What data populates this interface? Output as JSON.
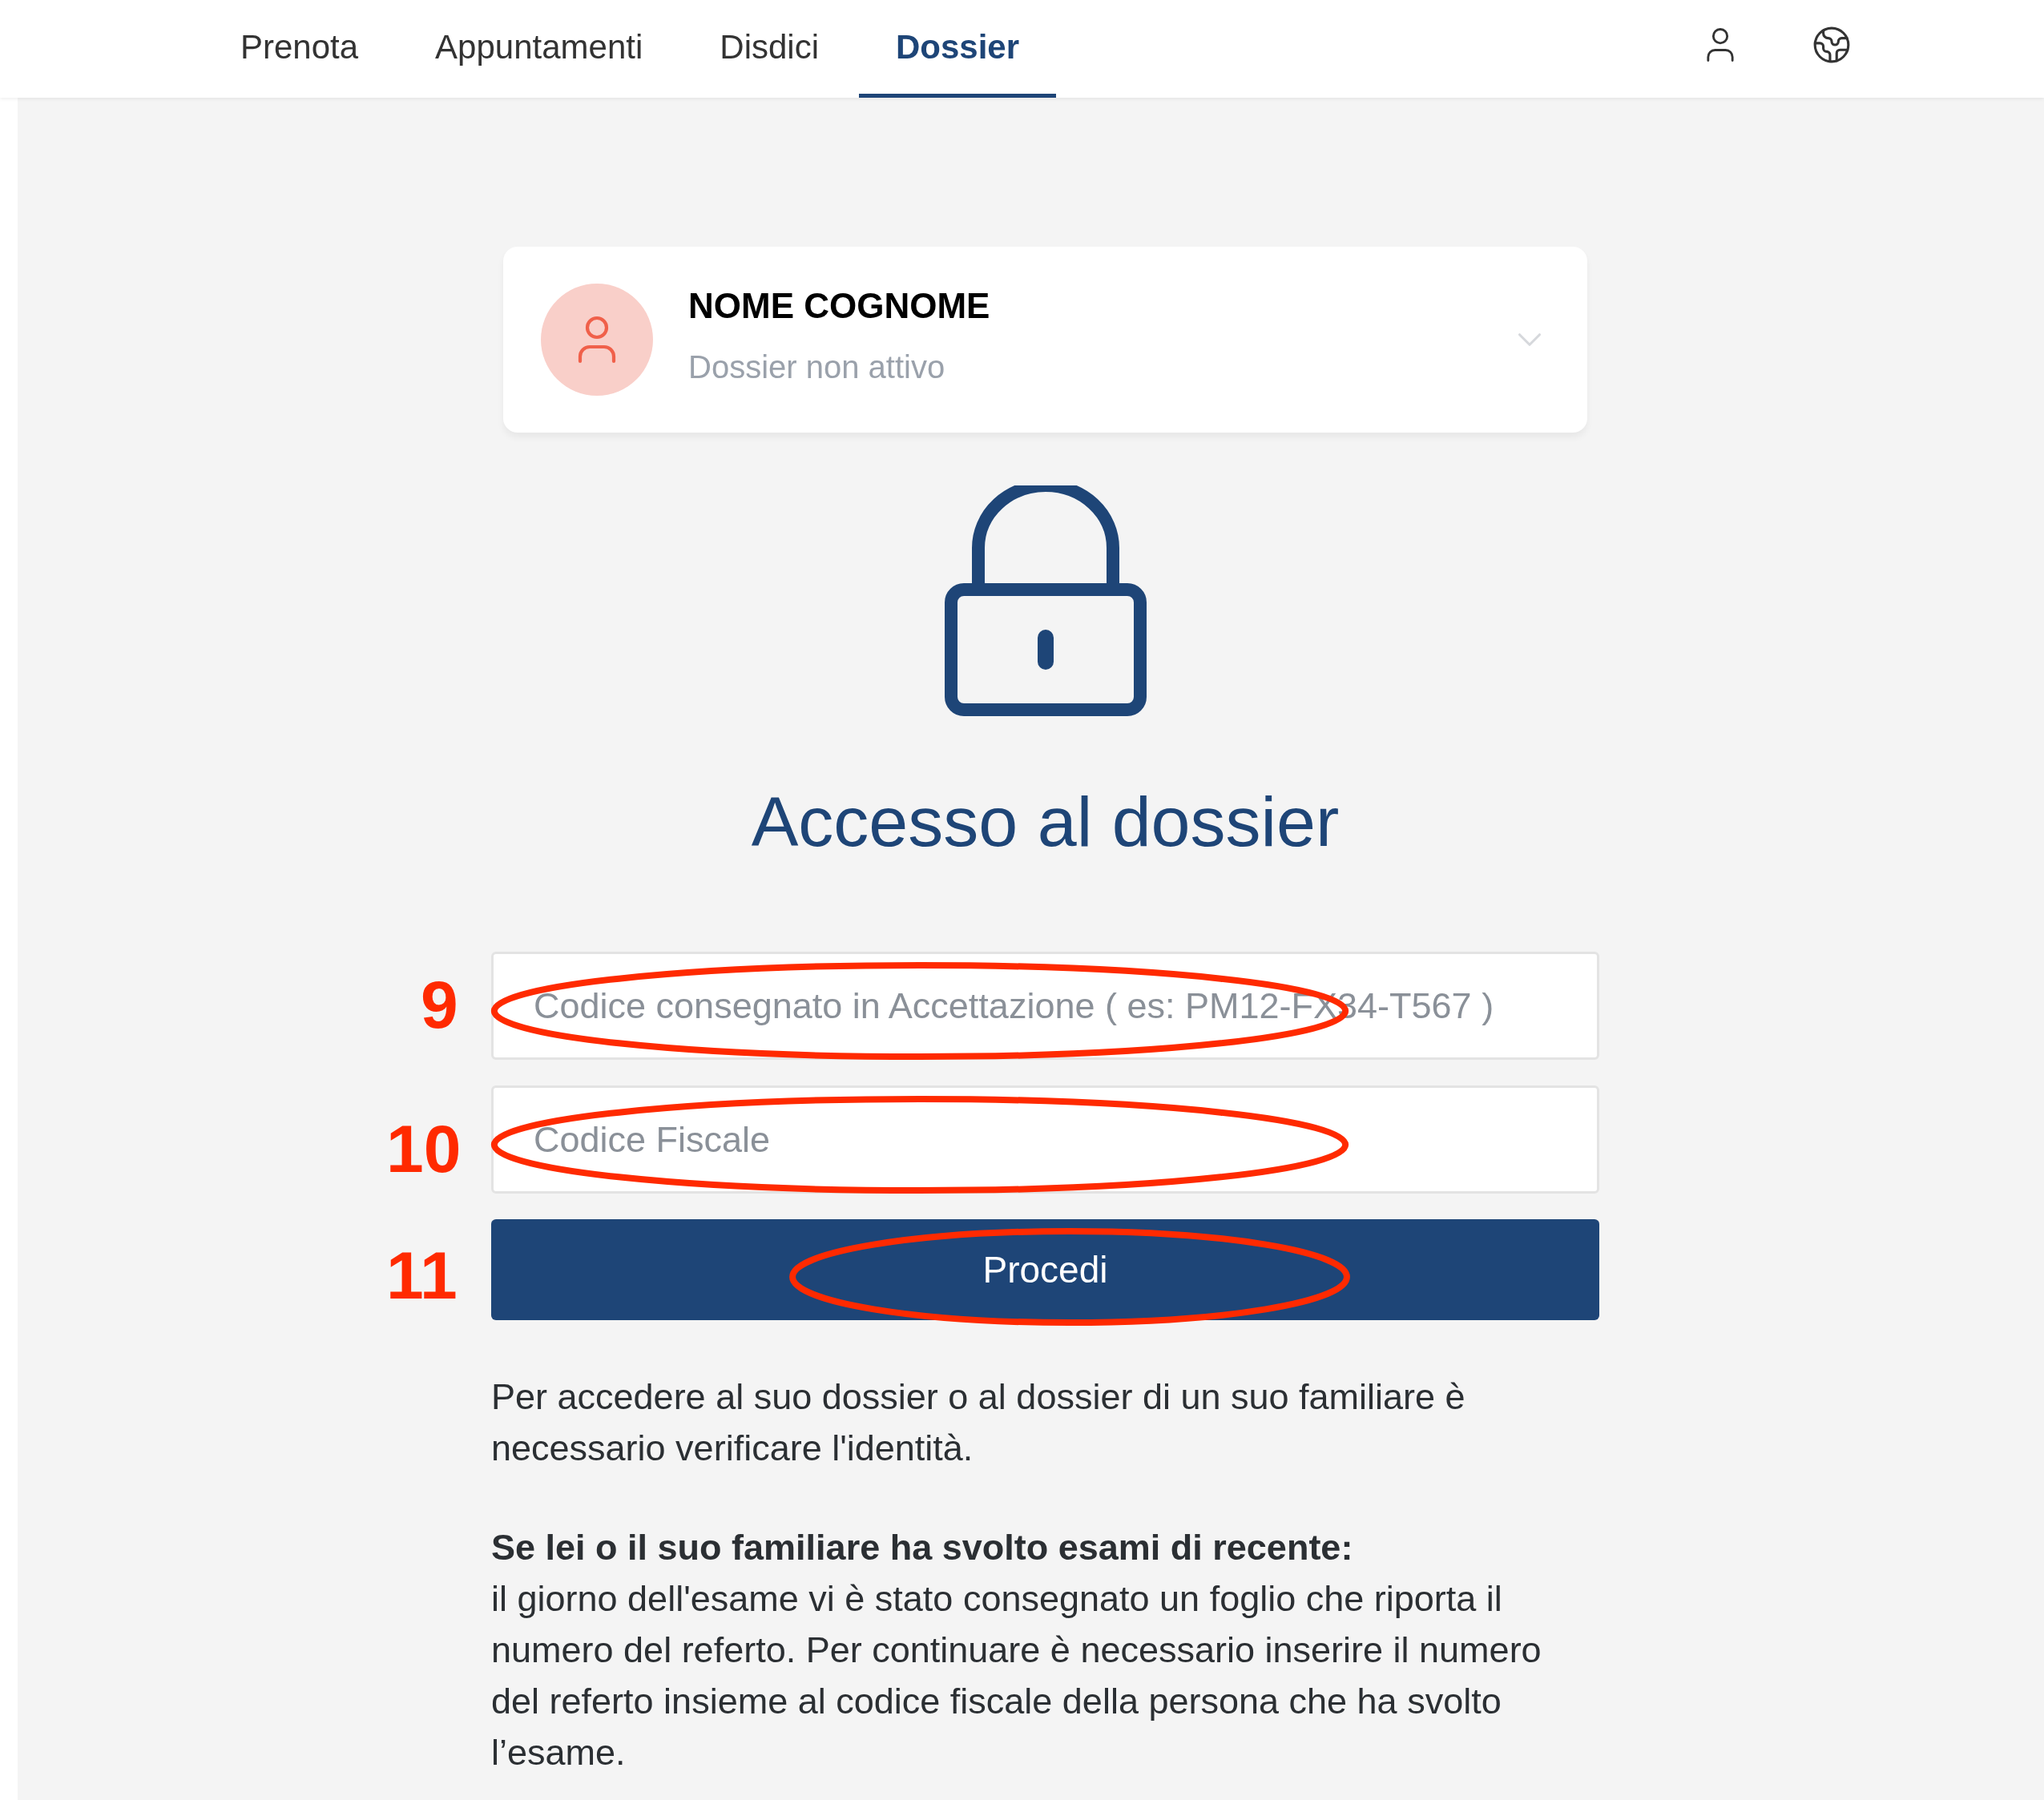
{
  "nav": {
    "tabs": [
      {
        "label": "Prenota",
        "selected": false
      },
      {
        "label": "Appuntamenti",
        "selected": false
      },
      {
        "label": "Disdici",
        "selected": false
      },
      {
        "label": "Dossier",
        "selected": true
      }
    ]
  },
  "profile": {
    "name": "NOME COGNOME",
    "status": "Dossier non attivo"
  },
  "heading": "Accesso al dossier",
  "form": {
    "fields": [
      {
        "placeholder": "Codice consegnato in Accettazione ( es: PM12-FX34-T567 )"
      },
      {
        "placeholder": "Codice Fiscale"
      }
    ],
    "submit": "Procedi"
  },
  "info": [
    {
      "kind": "text",
      "text": "Per accedere al suo dossier o al dossier di un suo familiare è necessario verificare l'identità."
    },
    {
      "kind": "heading",
      "text": "Se lei o il suo familiare ha svolto esami di recente:"
    },
    {
      "kind": "text",
      "text": "il giorno dell'esame vi è stato consegnato un foglio che riporta il numero del referto. Per continuare è necessario inserire il numero del referto insieme al codice fiscale della persona che ha svolto l’esame."
    }
  ],
  "annotations": [
    {
      "label": "9"
    },
    {
      "label": "10"
    },
    {
      "label": "11"
    }
  ]
}
